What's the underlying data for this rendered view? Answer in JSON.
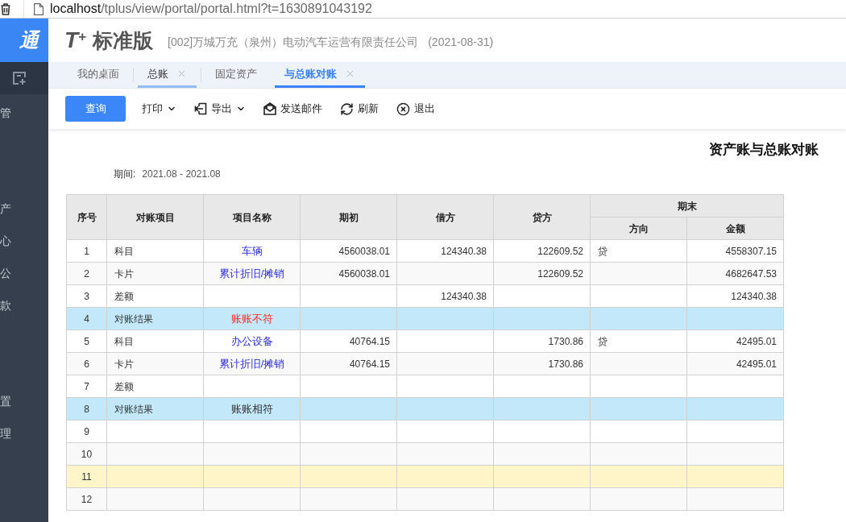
{
  "address_bar": {
    "host": "localhost",
    "path": "/tplus/view/portal/portal.html?t=1630891043192"
  },
  "sidebar": {
    "brand": "通",
    "groups": [
      [
        {
          "label": "管"
        }
      ],
      [
        {
          "label": "产"
        },
        {
          "label": "心"
        },
        {
          "label": "公"
        },
        {
          "label": "款"
        }
      ],
      [
        {
          "label": "置"
        },
        {
          "label": "理"
        }
      ]
    ]
  },
  "header": {
    "logo": "T$^{+}$",
    "edition": "标准版",
    "company": "[002]万城万充（泉州）电动汽车运营有限责任公司",
    "date": "(2021-08-31)"
  },
  "tabs": [
    {
      "label": "我的桌面",
      "selected": false,
      "hovered": false,
      "closable": false
    },
    {
      "label": "总账",
      "selected": false,
      "hovered": true,
      "closable": true
    },
    {
      "label": "固定资产",
      "selected": false,
      "hovered": false,
      "closable": false
    },
    {
      "label": "与总账对账",
      "selected": true,
      "hovered": false,
      "closable": true
    }
  ],
  "toolbar": [
    {
      "kind": "primary",
      "label": "查询"
    },
    {
      "kind": "tool",
      "label": "打印",
      "dropdown": true
    },
    {
      "kind": "tool",
      "label": "导出",
      "dropdown": true
    },
    {
      "kind": "tool",
      "label": "发送邮件",
      "dropdown": false
    },
    {
      "kind": "tool",
      "label": "刷新",
      "dropdown": false
    },
    {
      "kind": "tool",
      "label": "退出",
      "dropdown": false
    }
  ],
  "report": {
    "title": "资产账与总账对账",
    "period_label": "期间:",
    "period": "2021.08 - 2021.08"
  },
  "table": {
    "columns": [
      {
        "label": "序号"
      },
      {
        "label": "对账项目"
      },
      {
        "label": "项目名称"
      },
      {
        "label": "期初"
      },
      {
        "label": "借方"
      },
      {
        "label": "贷方"
      },
      {
        "label": "期末",
        "subcolumns": [
          {
            "label": "方向"
          },
          {
            "label": "金额"
          }
        ]
      }
    ],
    "rows": [
      {
        "kind": "detail",
        "selected": false,
        "seq": "1",
        "item": "科目",
        "name": {
          "text": "车辆",
          "color": "#3030d8"
        },
        "opening": "4560038.01",
        "debit": "124340.38",
        "credit": "122609.52",
        "direction": "贷",
        "amount": "4558307.15"
      },
      {
        "kind": "detail",
        "selected": false,
        "seq": "2",
        "item": "卡片",
        "name": {
          "text": "累计折旧/摊销",
          "color": "#3030d8"
        },
        "opening": "4560038.01",
        "credit": "122609.52",
        "amount": "4682647.53"
      },
      {
        "kind": "detail",
        "selected": false,
        "seq": "3",
        "item": "差额",
        "debit": "124340.38",
        "amount": "124340.38"
      },
      {
        "kind": "result",
        "selected": false,
        "seq": "4",
        "item": "对账结果",
        "name": {
          "text": "账账不符",
          "color": "#ff2a2a"
        }
      },
      {
        "kind": "detail",
        "selected": false,
        "seq": "5",
        "item": "科目",
        "name": {
          "text": "办公设备",
          "color": "#3030d8"
        },
        "opening": "40764.15",
        "credit": "1730.86",
        "direction": "贷",
        "amount": "42495.01"
      },
      {
        "kind": "detail",
        "selected": false,
        "seq": "6",
        "item": "卡片",
        "name": {
          "text": "累计折旧/摊销",
          "color": "#3030d8"
        },
        "opening": "40764.15",
        "credit": "1730.86",
        "amount": "42495.01"
      },
      {
        "kind": "detail",
        "selected": false,
        "seq": "7",
        "item": "差额"
      },
      {
        "kind": "result",
        "selected": false,
        "seq": "8",
        "item": "对账结果",
        "name": {
          "text": "账账相符",
          "color": "#333333"
        }
      },
      {
        "kind": "detail",
        "selected": false,
        "seq": "9"
      },
      {
        "kind": "detail",
        "selected": false,
        "seq": "10"
      },
      {
        "kind": "detail",
        "selected": true,
        "seq": "11"
      },
      {
        "kind": "detail",
        "selected": false,
        "seq": "12"
      }
    ]
  }
}
